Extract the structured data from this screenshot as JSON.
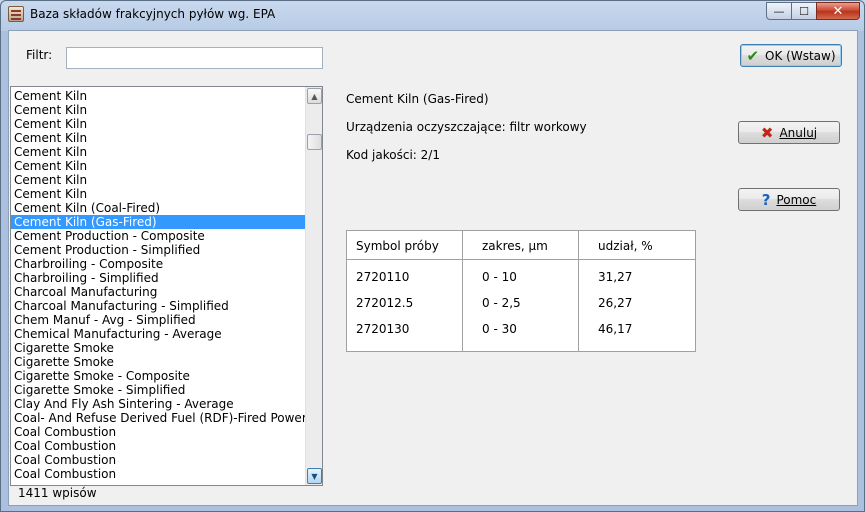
{
  "window": {
    "title": "Baza składów frakcyjnych pyłów wg. EPA",
    "minimize_glyph": "—",
    "maximize_glyph": "☐",
    "close_glyph": "✕"
  },
  "filter": {
    "label": "Filtr:",
    "value": ""
  },
  "list": {
    "items": [
      "Cement Kiln",
      "Cement Kiln",
      "Cement Kiln",
      "Cement Kiln",
      "Cement Kiln",
      "Cement Kiln",
      "Cement Kiln",
      "Cement Kiln",
      "Cement Kiln (Coal-Fired)",
      "Cement Kiln (Gas-Fired)",
      "Cement Production - Composite",
      "Cement Production - Simplified",
      "Charbroiling - Composite",
      "Charbroiling - Simplified",
      "Charcoal Manufacturing",
      "Charcoal Manufacturing - Simplified",
      "Chem Manuf - Avg - Simplified",
      "Chemical Manufacturing - Average",
      "Cigarette Smoke",
      "Cigarette Smoke",
      "Cigarette Smoke - Composite",
      "Cigarette Smoke - Simplified",
      "Clay And Fly Ash Sintering - Average",
      "Coal- And Refuse Derived Fuel (RDF)-Fired Power Plant",
      "Coal Combustion",
      "Coal Combustion",
      "Coal Combustion",
      "Coal Combustion"
    ],
    "selected_index": 9,
    "scroll_up_glyph": "▲",
    "scroll_down_glyph": "▼"
  },
  "status": {
    "count_text": "1411 wpisów"
  },
  "details": {
    "name": "Cement Kiln (Gas-Fired)",
    "device": "Urządzenia oczyszczające: filtr workowy",
    "quality": "Kod jakości: 2/1"
  },
  "buttons": {
    "ok": {
      "label": "OK (Wstaw)",
      "icon": "✔"
    },
    "cancel": {
      "label": "Anuluj",
      "icon": "✖"
    },
    "help": {
      "label": "Pomoc",
      "icon": "?"
    }
  },
  "table": {
    "headers": [
      "Symbol próby",
      "zakres, µm",
      "udział, %"
    ],
    "rows": [
      [
        "2720110",
        "0 - 10",
        "31,27"
      ],
      [
        "272012.5",
        "0 - 2,5",
        "26,27"
      ],
      [
        "2720130",
        "0 - 30",
        "46,17"
      ]
    ]
  },
  "colors": {
    "selection": "#3399ff",
    "ok_icon": "#2a8a1a",
    "cancel_icon": "#c0281a",
    "help_icon": "#1f64b8"
  }
}
